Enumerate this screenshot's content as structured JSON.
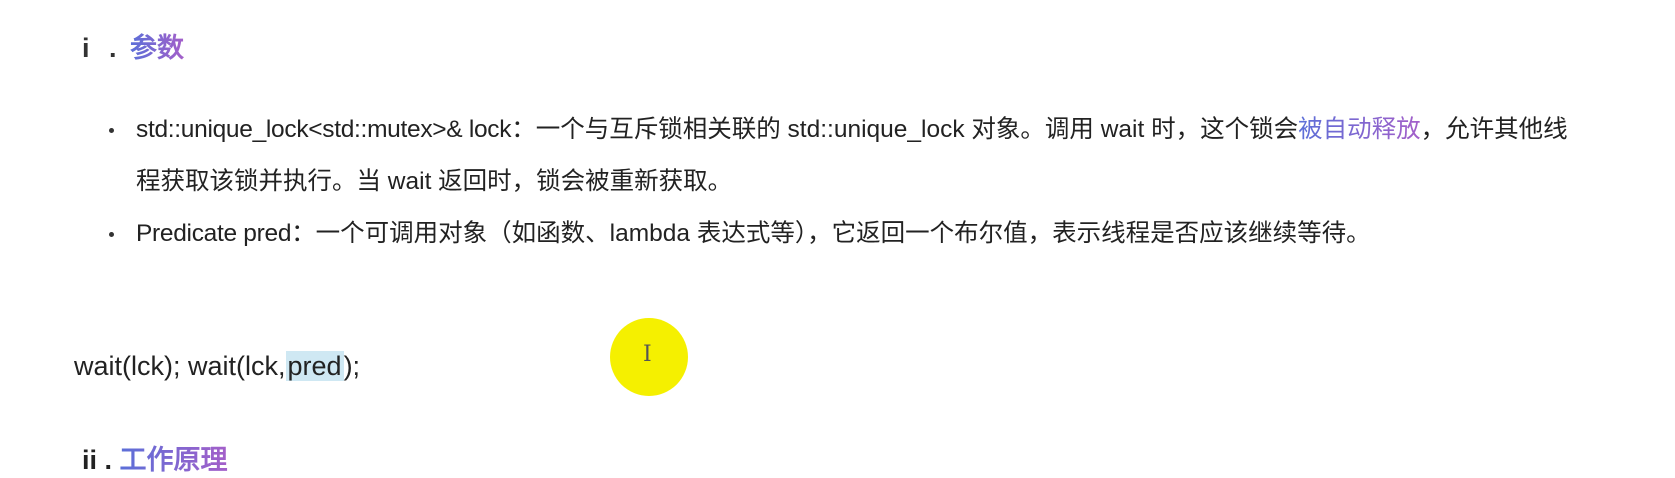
{
  "section": {
    "number": "i .",
    "title": "参数"
  },
  "bullets": [
    {
      "term": "std::unique_lock<std::mutex>& lock",
      "text_before": "：一个与互斥锁相关联的 std::unique_lock 对象。调用 wait 时，这个锁会",
      "highlight": "被自动释放",
      "text_after": "，允许其他线程获取该锁并执行。当 wait 返回时，锁会被重新获取。"
    },
    {
      "term": "Predicate pred",
      "text_before": "：一个可调用对象（如函数、lambda 表达式等），它返回一个布尔值，表示线程是否应该继续等待。",
      "highlight": "",
      "text_after": ""
    }
  ],
  "code_line": {
    "before_selection": "wait(lck); wait(lck,",
    "selection": "pred",
    "after_selection": ");"
  },
  "cursor": {
    "glyph": "I",
    "highlight_color": "#f5f000"
  },
  "next_section": {
    "number": "ii .",
    "title": "工作原理"
  },
  "colors": {
    "accent_start": "#5b6fd8",
    "accent_end": "#a45fc9",
    "selection": "#cfe8f3"
  }
}
